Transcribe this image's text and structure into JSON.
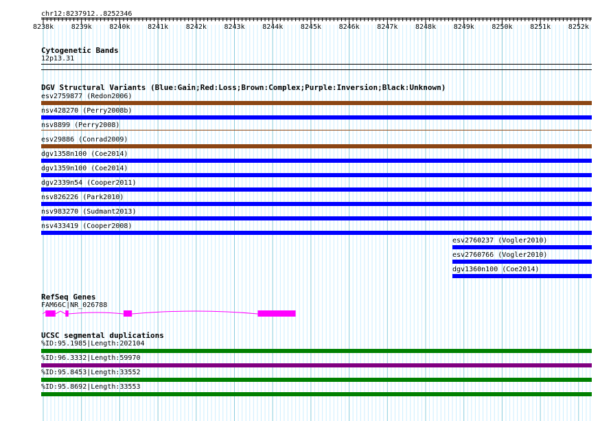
{
  "position": "chr12:8237912..8252346",
  "ruler": {
    "ticks": [
      "8238k",
      "8239k",
      "8240k",
      "8241k",
      "8242k",
      "8243k",
      "8244k",
      "8245k",
      "8246k",
      "8247k",
      "8248k",
      "8249k",
      "8250k",
      "8251k",
      "8252k"
    ]
  },
  "tracks": {
    "cyto": {
      "title": "Cytogenetic Bands",
      "band": "12p13.31"
    },
    "dgv": {
      "title": "DGV Structural Variants (Blue:Gain;Red:Loss;Brown:Complex;Purple:Inversion;Black:Unknown)",
      "features": [
        {
          "label": "esv2759877 (Redon2006)",
          "color": "#8b4513",
          "start": 8237912,
          "end": 8252346
        },
        {
          "label": "nsv428270 (Perry2008b)",
          "color": "#0000ff",
          "start": 8237912,
          "end": 8252346
        },
        {
          "label": "nsv8899 (Perry2008)",
          "color": "#8b4513",
          "start": 8237912,
          "end": 8252346
        },
        {
          "label": "esv29886 (Conrad2009)",
          "color": "#8b4513",
          "start": 8237912,
          "end": 8252346
        },
        {
          "label": "dgv1358n100 (Coe2014)",
          "color": "#0000ff",
          "start": 8237912,
          "end": 8252346
        },
        {
          "label": "dgv1359n100 (Coe2014)",
          "color": "#0000ff",
          "start": 8237912,
          "end": 8252346
        },
        {
          "label": "dgv2339n54 (Cooper2011)",
          "color": "#0000ff",
          "start": 8237912,
          "end": 8252346
        },
        {
          "label": "nsv826226 (Park2010)",
          "color": "#0000ff",
          "start": 8237912,
          "end": 8252346
        },
        {
          "label": "nsv983270 (Sudmant2013)",
          "color": "#0000ff",
          "start": 8237912,
          "end": 8252346
        },
        {
          "label": "nsv433419 (Cooper2008)",
          "color": "#0000ff",
          "start": 8237912,
          "end": 8252346
        },
        {
          "label": "esv2760237 (Vogler2010)",
          "color": "#0000ff",
          "start": 8248700,
          "end": 8252346
        },
        {
          "label": "esv2760766 (Vogler2010)",
          "color": "#0000ff",
          "start": 8248700,
          "end": 8252346
        },
        {
          "label": "dgv1360n100 (Coe2014)",
          "color": "#0000ff",
          "start": 8248700,
          "end": 8252346
        }
      ]
    },
    "refseq": {
      "title": "RefSeq Genes",
      "gene_label": "FAM66C|NR_026788",
      "color": "#ff00ff",
      "gene_start": 8237912,
      "gene_end": 8244600,
      "exons": [
        [
          8238060,
          8238320
        ],
        [
          8238580,
          8238660
        ],
        [
          8240100,
          8240320
        ],
        [
          8243610,
          8244600
        ]
      ]
    },
    "segdup": {
      "title": "UCSC segmental duplications",
      "features": [
        {
          "label": "%ID:95.1985|Length:202104",
          "color": "#008000"
        },
        {
          "label": "%ID:96.3332|Length:59970",
          "color": "#800080"
        },
        {
          "label": "%ID:95.8453|Length:33552",
          "color": "#008000"
        },
        {
          "label": "%ID:95.8692|Length:33553",
          "color": "#008000"
        }
      ]
    }
  },
  "colors": {
    "grid_minor": "#cceeff",
    "grid_major": "#88ccdd",
    "ruler": "#000000"
  }
}
